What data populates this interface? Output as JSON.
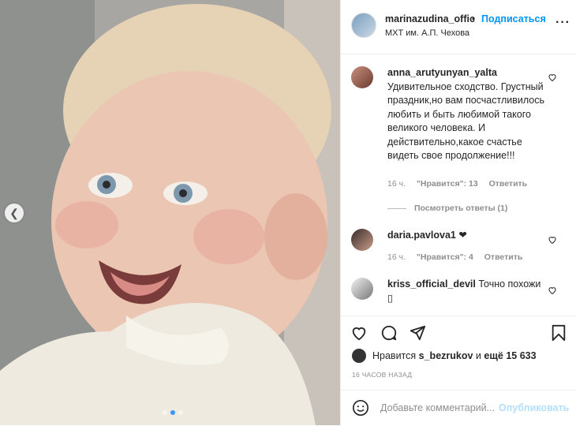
{
  "header": {
    "username": "marinazudina_offic",
    "separator": "•",
    "follow_label": "Подписаться",
    "location": "МХТ им. А.П. Чехова"
  },
  "comments": [
    {
      "username": "anna_arutyunyan_yalta",
      "text": "Удивительное сходство. Грустный праздник,но вам посчастливилось любить и быть любимой такого великого человека. И действительно,какое счастье видеть свое продолжение!!!",
      "time": "16 ч.",
      "likes": "\"Нравится\": 13",
      "reply": "Ответить",
      "view_replies": "Посмотреть ответы (1)"
    },
    {
      "username": "daria.pavlova1",
      "text": "❤",
      "time": "16 ч.",
      "likes": "\"Нравится\": 4",
      "reply": "Ответить"
    },
    {
      "username": "kriss_official_devil",
      "text": "Точно похожи",
      "text2": "▯"
    }
  ],
  "likes_bar": {
    "prefix": "Нравится",
    "user": "s_bezrukov",
    "middle": "и",
    "count": "ещё 15 633"
  },
  "timestamp": "16 ЧАСОВ НАЗАД",
  "add_comment": {
    "placeholder": "Добавьте комментарий...",
    "post_label": "Опубликовать"
  },
  "icons": {
    "carousel_prev": "chevron-left-icon",
    "more": "more-dots-icon",
    "like": "heart-icon",
    "comment": "comment-icon",
    "share": "share-icon",
    "save": "bookmark-icon",
    "emoji": "emoji-icon"
  },
  "carousel": {
    "active_index": 1,
    "total": 3
  },
  "colors": {
    "accent": "#0095f6",
    "muted": "#8e8e8e",
    "text": "#262626"
  }
}
